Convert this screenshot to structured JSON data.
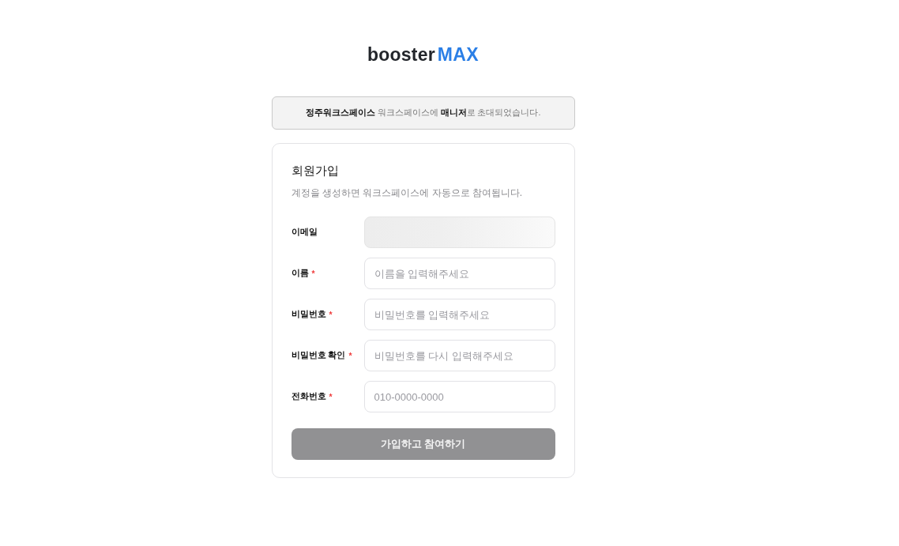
{
  "logo": {
    "text": "booster",
    "accent": "MAX"
  },
  "banner": {
    "message": "**정주워크스페이스** 워크스페이스에 **매니저**로 초대되었습니다."
  },
  "form": {
    "title": "회원가입",
    "subtitle": "계정을 생성하면 워크스페이스에 자동으로 참여됩니다.",
    "fields": [
      {
        "label": "이메일",
        "disabled": true
      },
      {
        "label": "이름",
        "required_mark": "*",
        "placeholder": "이름을 입력해주세요",
        "disabled": false
      },
      {
        "label": "비밀번호",
        "required_mark": "*",
        "placeholder": "비밀번호를 입력해주세요",
        "disabled": false
      },
      {
        "label": "비밀번호 확인",
        "required_mark": "*",
        "placeholder": "비밀번호를 다시 입력해주세요",
        "disabled": false
      },
      {
        "label": "전화번호",
        "required_mark": "*",
        "placeholder": "010-0000-0000",
        "disabled": false
      }
    ],
    "submit": {
      "label": "가입하고 참여하기",
      "disabled": true
    }
  }
}
